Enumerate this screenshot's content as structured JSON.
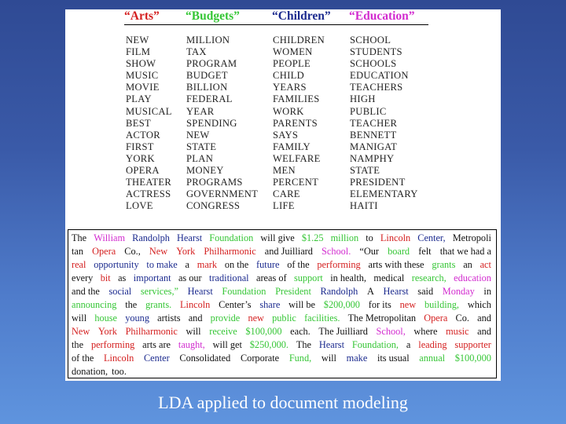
{
  "colors": {
    "arts": "#d42020",
    "budgets": "#36c636",
    "children": "#1b2a8e",
    "education": "#d22bcf",
    "background_top": "#2f4a94",
    "background_bottom": "#5f94de"
  },
  "topics": [
    {
      "key": "arts",
      "label": "“Arts”",
      "words": [
        "NEW",
        "FILM",
        "SHOW",
        "MUSIC",
        "MOVIE",
        "PLAY",
        "MUSICAL",
        "BEST",
        "ACTOR",
        "FIRST",
        "YORK",
        "OPERA",
        "THEATER",
        "ACTRESS",
        "LOVE"
      ]
    },
    {
      "key": "budgets",
      "label": "“Budgets”",
      "words": [
        "MILLION",
        "TAX",
        "PROGRAM",
        "BUDGET",
        "BILLION",
        "FEDERAL",
        "YEAR",
        "SPENDING",
        "NEW",
        "STATE",
        "PLAN",
        "MONEY",
        "PROGRAMS",
        "GOVERNMENT",
        "CONGRESS"
      ]
    },
    {
      "key": "children",
      "label": "“Children”",
      "words": [
        "CHILDREN",
        "WOMEN",
        "PEOPLE",
        "CHILD",
        "YEARS",
        "FAMILIES",
        "WORK",
        "PARENTS",
        "SAYS",
        "FAMILY",
        "WELFARE",
        "MEN",
        "PERCENT",
        "CARE",
        "LIFE"
      ]
    },
    {
      "key": "education",
      "label": "“Education”",
      "words": [
        "SCHOOL",
        "STUDENTS",
        "SCHOOLS",
        "EDUCATION",
        "TEACHERS",
        "HIGH",
        "PUBLIC",
        "TEACHER",
        "BENNETT",
        "MANIGAT",
        "NAMPHY",
        "STATE",
        "PRESIDENT",
        "ELEMENTARY",
        "HAITI"
      ]
    }
  ],
  "document": {
    "lines": [
      [
        [
          "The",
          ""
        ],
        [
          "William",
          "education"
        ],
        [
          "Randolph",
          "children"
        ],
        [
          "Hearst",
          "children"
        ],
        [
          "Foundation",
          "budgets"
        ],
        [
          "will give",
          ""
        ],
        [
          "$1.25",
          "budgets"
        ],
        [
          "million",
          "budgets"
        ],
        [
          "to",
          ""
        ],
        [
          "Lincoln",
          "arts"
        ],
        [
          "Center,",
          "children"
        ],
        [
          "Metropoli",
          ""
        ]
      ],
      [
        [
          "tan",
          ""
        ],
        [
          "Opera",
          "arts"
        ],
        [
          "Co.,",
          ""
        ],
        [
          "New",
          "arts"
        ],
        [
          "York",
          "arts"
        ],
        [
          "Philharmonic",
          "arts"
        ],
        [
          "and Juilliard",
          ""
        ],
        [
          "School.",
          "education"
        ],
        [
          "“Our",
          ""
        ],
        [
          "board",
          "budgets"
        ],
        [
          "felt",
          ""
        ],
        [
          "that we had a",
          ""
        ]
      ],
      [
        [
          "real",
          "arts"
        ],
        [
          "opportunity",
          "children"
        ],
        [
          "to make",
          "children"
        ],
        [
          "a",
          ""
        ],
        [
          "mark",
          "arts"
        ],
        [
          "on the",
          ""
        ],
        [
          "future",
          "children"
        ],
        [
          "of the",
          ""
        ],
        [
          "performing",
          "arts"
        ],
        [
          "arts with these",
          ""
        ],
        [
          "grants",
          "budgets"
        ],
        [
          "an",
          ""
        ],
        [
          "act",
          "arts"
        ]
      ],
      [
        [
          "every",
          ""
        ],
        [
          "bit",
          "arts"
        ],
        [
          "as",
          ""
        ],
        [
          "important",
          "children"
        ],
        [
          "as our",
          ""
        ],
        [
          "traditional",
          "children"
        ],
        [
          "areas of",
          ""
        ],
        [
          "support",
          "budgets"
        ],
        [
          "in health,",
          ""
        ],
        [
          "medical",
          ""
        ],
        [
          "research,",
          "budgets"
        ],
        [
          "education",
          "education"
        ]
      ],
      [
        [
          "and the",
          ""
        ],
        [
          "social",
          "children"
        ],
        [
          "services,”",
          "budgets"
        ],
        [
          "Hearst",
          "children"
        ],
        [
          "Foundation",
          "budgets"
        ],
        [
          "President",
          "budgets"
        ],
        [
          "Randolph",
          "children"
        ],
        [
          "A",
          ""
        ],
        [
          "Hearst",
          "children"
        ],
        [
          "said",
          ""
        ],
        [
          "Monday",
          "education"
        ],
        [
          "in",
          ""
        ]
      ],
      [
        [
          "announcing",
          "budgets"
        ],
        [
          "the",
          ""
        ],
        [
          "grants.",
          "budgets"
        ],
        [
          "Lincoln",
          "arts"
        ],
        [
          "Center’s",
          ""
        ],
        [
          "share",
          "children"
        ],
        [
          "will be",
          ""
        ],
        [
          "$200,000",
          "budgets"
        ],
        [
          "for its",
          ""
        ],
        [
          "new",
          "arts"
        ],
        [
          "building,",
          "budgets"
        ],
        [
          "which",
          ""
        ]
      ],
      [
        [
          "will",
          ""
        ],
        [
          "house",
          "budgets"
        ],
        [
          "young",
          "children"
        ],
        [
          "artists",
          ""
        ],
        [
          "and",
          ""
        ],
        [
          "provide",
          "budgets"
        ],
        [
          "new",
          "arts"
        ],
        [
          "public",
          "budgets"
        ],
        [
          "facilities.",
          "budgets"
        ],
        [
          "The Metropolitan",
          ""
        ],
        [
          "Opera",
          "arts"
        ],
        [
          "Co.",
          ""
        ],
        [
          "and",
          ""
        ]
      ],
      [
        [
          "New",
          "arts"
        ],
        [
          "York",
          "arts"
        ],
        [
          "Philharmonic",
          "arts"
        ],
        [
          "will",
          ""
        ],
        [
          "receive",
          "budgets"
        ],
        [
          "$100,000",
          "budgets"
        ],
        [
          "each.",
          ""
        ],
        [
          "The Juilliard",
          ""
        ],
        [
          "School,",
          "education"
        ],
        [
          "where",
          ""
        ],
        [
          "music",
          "arts"
        ],
        [
          "and",
          ""
        ]
      ],
      [
        [
          "the",
          ""
        ],
        [
          "performing",
          "arts"
        ],
        [
          "arts are",
          ""
        ],
        [
          "taught,",
          "education"
        ],
        [
          "will get",
          ""
        ],
        [
          "$250,000.",
          "budgets"
        ],
        [
          "The",
          ""
        ],
        [
          "Hearst",
          "children"
        ],
        [
          "Foundation,",
          "budgets"
        ],
        [
          "a",
          ""
        ],
        [
          "leading",
          "arts"
        ],
        [
          "supporter",
          "arts"
        ]
      ],
      [
        [
          "of the",
          ""
        ],
        [
          "Lincoln",
          "arts"
        ],
        [
          "Center",
          "children"
        ],
        [
          "Consolidated",
          ""
        ],
        [
          "Corporate",
          ""
        ],
        [
          "Fund,",
          "budgets"
        ],
        [
          "will",
          ""
        ],
        [
          "make",
          "children"
        ],
        [
          "its usual",
          ""
        ],
        [
          "annual",
          "budgets"
        ],
        [
          "$100,000",
          "budgets"
        ]
      ],
      [
        [
          "donation,",
          ""
        ],
        [
          "too.",
          ""
        ]
      ]
    ]
  },
  "caption": "LDA applied to document modeling"
}
